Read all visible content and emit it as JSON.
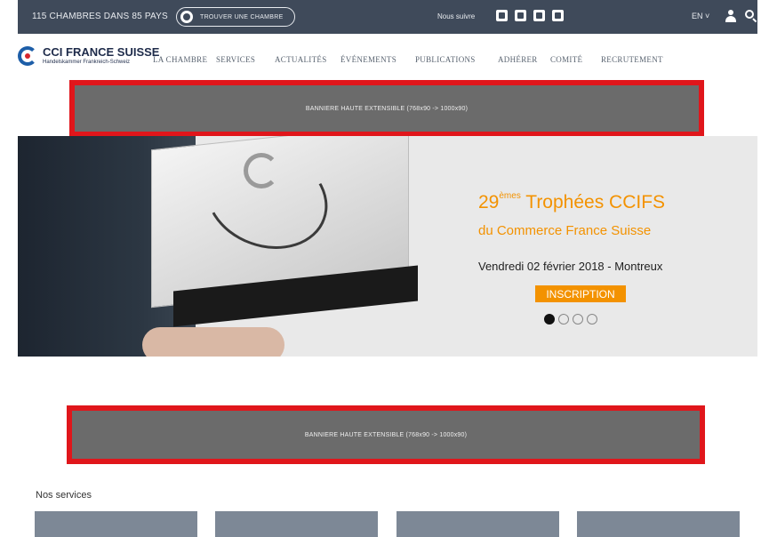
{
  "topbar": {
    "count": "115 CHAMBRES DANS 85 PAYS",
    "find_label": "TROUVER UNE CHAMBRE",
    "follow": "Nous suivre",
    "social": [
      "facebook-icon",
      "twitter-icon",
      "linkedin-icon",
      "youtube-icon"
    ],
    "lang": "EN ˅"
  },
  "logo": {
    "name": "CCI FRANCE SUISSE",
    "sub": "Handelskammer Frankreich-Schweiz"
  },
  "nav": [
    "LA CHAMBRE",
    "SERVICES",
    "ACTUALITÉS",
    "ÉVÉNEMENTS",
    "PUBLICATIONS",
    "ADHÉRER",
    "COMITÉ",
    "RECRUTEMENT"
  ],
  "banners": {
    "top": "BANNIERE HAUTE EXTENSIBLE (768x90 -> 1000x90)",
    "middle": "BANNIERE HAUTE EXTENSIBLE (768x90 -> 1000x90)"
  },
  "hero": {
    "title_number": "29",
    "title_sup": "èmes",
    "title_rest": " Trophées CCIFS",
    "subtitle": "du Commerce France Suisse",
    "date": "Vendredi 02 février 2018 - Montreux",
    "cta": "INSCRIPTION",
    "slide_count": 4,
    "active_slide": 1
  },
  "services": {
    "title": "Nos services"
  },
  "colors": {
    "topbar": "#3f4a5a",
    "accent": "#f39200",
    "banner_border": "#e0161b",
    "banner_fill": "#6b6b6b"
  }
}
